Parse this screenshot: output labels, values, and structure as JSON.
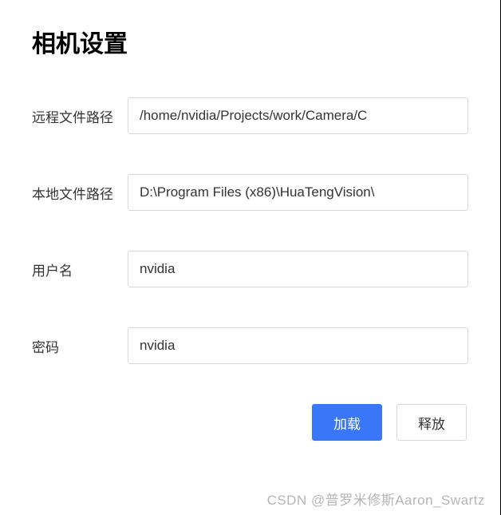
{
  "title": "相机设置",
  "fields": {
    "remote_path": {
      "label": "远程文件路径",
      "value": "/home/nvidia/Projects/work/Camera/C"
    },
    "local_path": {
      "label": "本地文件路径",
      "value": "D:\\Program Files (x86)\\HuaTengVision\\"
    },
    "username": {
      "label": "用户名",
      "value": "nvidia"
    },
    "password": {
      "label": "密码",
      "value": "nvidia"
    }
  },
  "buttons": {
    "load": "加载",
    "release": "释放"
  },
  "watermark": "CSDN @普罗米修斯Aaron_Swartz"
}
